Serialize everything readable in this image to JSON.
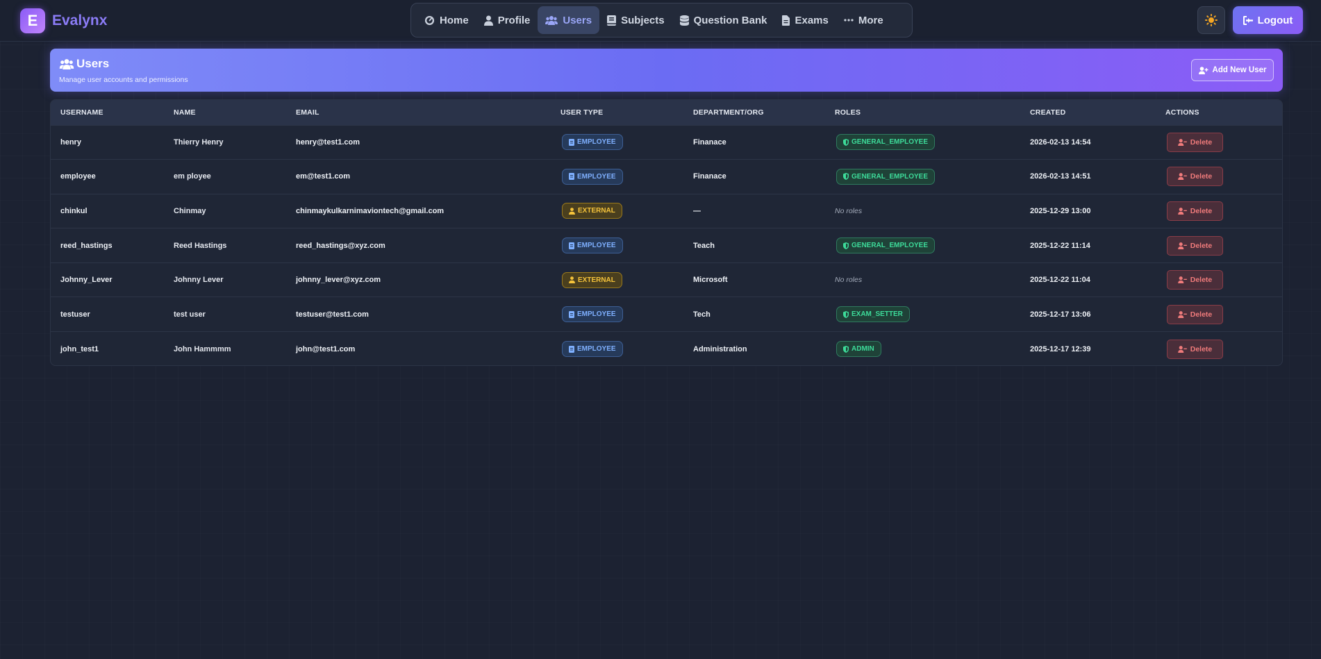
{
  "brand": {
    "logo_letter": "E",
    "name": "Evalynx"
  },
  "nav": {
    "items": [
      {
        "label": "Home",
        "icon": "gauge-icon"
      },
      {
        "label": "Profile",
        "icon": "user-icon"
      },
      {
        "label": "Users",
        "icon": "users-icon",
        "active": true
      },
      {
        "label": "Subjects",
        "icon": "book-icon"
      },
      {
        "label": "Question Bank",
        "icon": "database-icon"
      },
      {
        "label": "Exams",
        "icon": "file-icon"
      },
      {
        "label": "More",
        "icon": "ellipsis-icon"
      }
    ],
    "theme_icon": "sun-icon",
    "logout_label": "Logout"
  },
  "header": {
    "title": "Users",
    "subtitle": "Manage user accounts and permissions",
    "add_button_label": "Add New User"
  },
  "table": {
    "columns": [
      "Username",
      "Name",
      "Email",
      "User Type",
      "Department/Org",
      "Roles",
      "Created",
      "Actions"
    ],
    "delete_label": "Delete",
    "rows": [
      {
        "username": "henry",
        "name": "Thierry Henry",
        "email": "henry@test1.com",
        "user_type": "EMPLOYEE",
        "department": "Finanace",
        "role": "GENERAL_EMPLOYEE",
        "created": "2026-02-13 14:54"
      },
      {
        "username": "employee",
        "name": "em ployee",
        "email": "em@test1.com",
        "user_type": "EMPLOYEE",
        "department": "Finanace",
        "role": "GENERAL_EMPLOYEE",
        "created": "2026-02-13 14:51"
      },
      {
        "username": "chinkul",
        "name": "Chinmay",
        "email": "chinmaykulkarnimaviontech@gmail.com",
        "user_type": "EXTERNAL",
        "department": "—",
        "role": "No roles",
        "created": "2025-12-29 13:00"
      },
      {
        "username": "reed_hastings",
        "name": "Reed Hastings",
        "email": "reed_hastings@xyz.com",
        "user_type": "EMPLOYEE",
        "department": "Teach",
        "role": "GENERAL_EMPLOYEE",
        "created": "2025-12-22 11:14"
      },
      {
        "username": "Johnny_Lever",
        "name": "Johnny Lever",
        "email": "johnny_lever@xyz.com",
        "user_type": "EXTERNAL",
        "department": "Microsoft",
        "role": "No roles",
        "created": "2025-12-22 11:04"
      },
      {
        "username": "testuser",
        "name": "test user",
        "email": "testuser@test1.com",
        "user_type": "EMPLOYEE",
        "department": "Tech",
        "role": "EXAM_SETTER",
        "created": "2025-12-17 13:06"
      },
      {
        "username": "john_test1",
        "name": "John Hammmm",
        "email": "john@test1.com",
        "user_type": "EMPLOYEE",
        "department": "Administration",
        "role": "ADMIN",
        "created": "2025-12-17 12:39"
      }
    ]
  },
  "colors": {
    "accent": "#8b5cf6",
    "employee_badge": "#7fb0ff",
    "external_badge": "#f5c33b",
    "role_badge": "#3ddc9a",
    "delete": "#f07b7b"
  }
}
